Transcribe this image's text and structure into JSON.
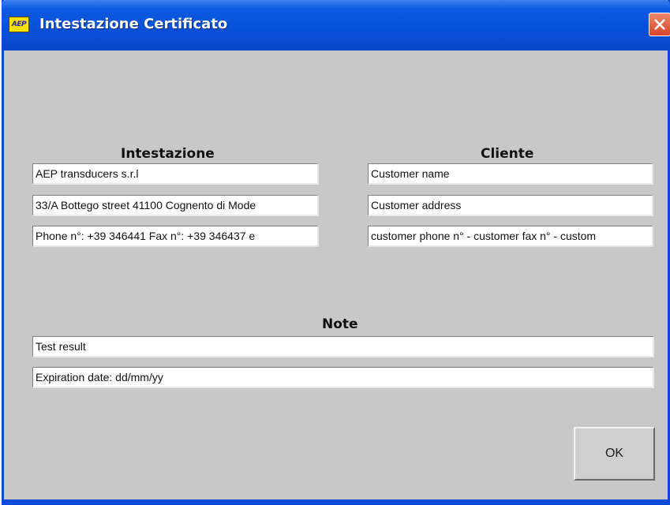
{
  "window": {
    "title": "Intestazione Certificato",
    "icon_label": "AEP"
  },
  "intestazione": {
    "heading": "Intestazione",
    "fields": [
      "AEP transducers s.r.l",
      "33/A Bottego street 41100 Cognento di Mode",
      "Phone n°: +39 346441  Fax n°: +39 346437  e"
    ]
  },
  "cliente": {
    "heading": "Cliente",
    "fields": [
      "Customer name",
      "Customer address",
      "customer phone n° - customer fax n° - custom"
    ]
  },
  "note": {
    "heading": "Note",
    "fields": [
      "Test result",
      "Expiration date: dd/mm/yy"
    ]
  },
  "buttons": {
    "ok_label": "OK"
  },
  "colors": {
    "titlebar": "#0650d8",
    "window_bg": "#c8c8c8",
    "close_button": "#d8442a"
  }
}
